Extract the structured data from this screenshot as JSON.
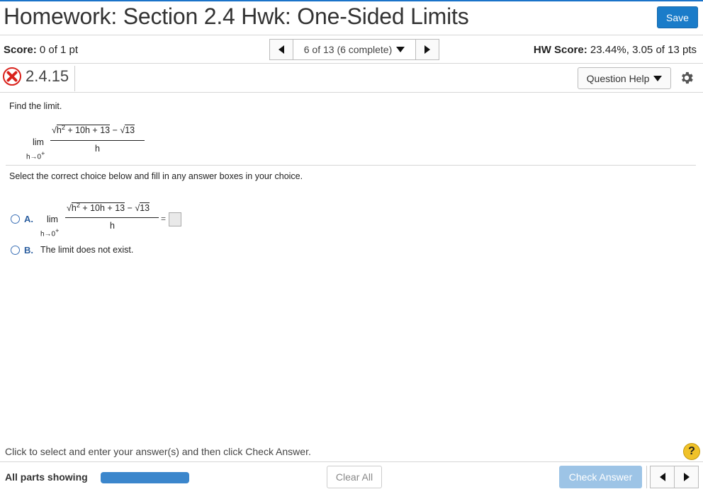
{
  "header": {
    "title": "Homework: Section 2.4 Hwk: One-Sided Limits",
    "save_label": "Save"
  },
  "scorebar": {
    "score_label": "Score:",
    "score_value": "0 of 1 pt",
    "nav_label": "6 of 13 (6 complete)",
    "hw_score_label": "HW Score:",
    "hw_score_value": "23.44%, 3.05 of 13 pts"
  },
  "question": {
    "number": "2.4.15",
    "status_icon": "x-icon",
    "help_label": "Question Help",
    "prompt": "Find the limit.",
    "lim": "lim",
    "lim_sub": "h→0",
    "lim_sup": "+",
    "num_radicand": "h",
    "num_exp": "2",
    "num_rest": " + 10h + 13",
    "minus": " − ",
    "num_sqrt2": "13",
    "denominator": "h",
    "instructions": "Select the correct choice below and fill in any answer boxes in your choice.",
    "option_a_label": "A.",
    "option_b_label": "B.",
    "option_b_text": "The limit does not exist.",
    "equals": "="
  },
  "footer": {
    "message": "Click to select and enter your answer(s) and then click Check Answer.",
    "all_parts": "All parts showing",
    "clear_label": "Clear All",
    "check_label": "Check Answer",
    "help_glyph": "?"
  },
  "colors": {
    "accent": "#1a7cc9",
    "error": "#d9221c"
  }
}
